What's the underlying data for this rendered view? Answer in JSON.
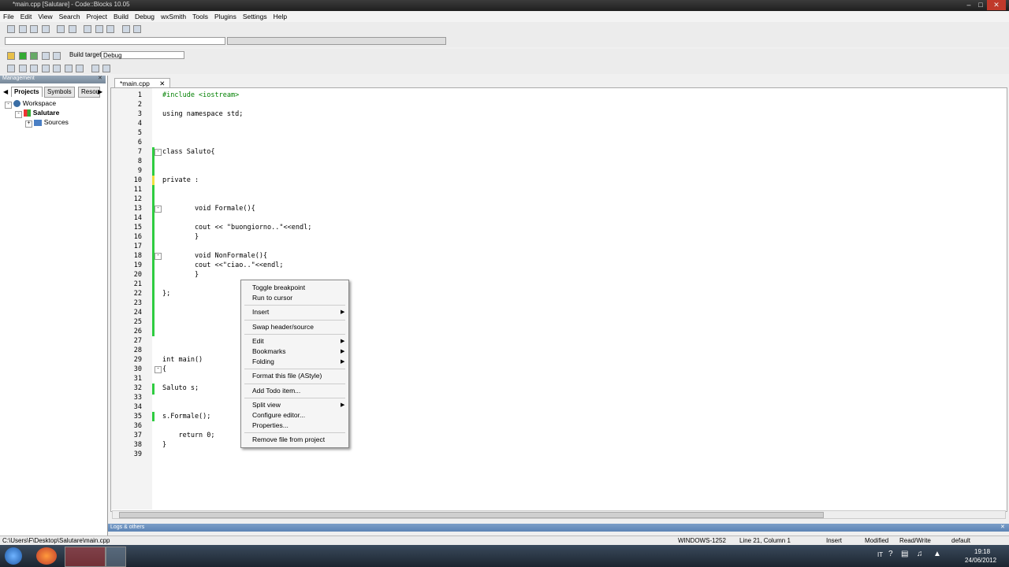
{
  "window": {
    "title": "*main.cpp [Salutare] - Code::Blocks 10.05"
  },
  "menu": [
    "File",
    "Edit",
    "View",
    "Search",
    "Project",
    "Build",
    "Debug",
    "wxSmith",
    "Tools",
    "Plugins",
    "Settings",
    "Help"
  ],
  "build": {
    "label": "Build target:",
    "value": "Debug"
  },
  "management": {
    "title": "Management",
    "tabs": [
      "Projects",
      "Symbols",
      "Resou"
    ],
    "tree": {
      "workspace": "Workspace",
      "project": "Salutare",
      "folder": "Sources"
    }
  },
  "editor": {
    "tab": "*main.cpp",
    "lines": [
      {
        "n": "1",
        "t": "#include <iostream>",
        "cls": "pre"
      },
      {
        "n": "2",
        "t": ""
      },
      {
        "n": "3",
        "t": "using namespace std;"
      },
      {
        "n": "4",
        "t": ""
      },
      {
        "n": "5",
        "t": ""
      },
      {
        "n": "6",
        "t": ""
      },
      {
        "n": "7",
        "t": "class Saluto{"
      },
      {
        "n": "8",
        "t": ""
      },
      {
        "n": "9",
        "t": ""
      },
      {
        "n": "10",
        "t": "private :"
      },
      {
        "n": "11",
        "t": ""
      },
      {
        "n": "12",
        "t": ""
      },
      {
        "n": "13",
        "t": "        void Formale(){"
      },
      {
        "n": "14",
        "t": ""
      },
      {
        "n": "15",
        "t": "        cout << \"buongiorno..\"<<endl;"
      },
      {
        "n": "16",
        "t": "        }"
      },
      {
        "n": "17",
        "t": ""
      },
      {
        "n": "18",
        "t": "        void NonFormale(){"
      },
      {
        "n": "19",
        "t": "        cout <<\"ciao..\"<<endl;"
      },
      {
        "n": "20",
        "t": "        }"
      },
      {
        "n": "21",
        "t": ""
      },
      {
        "n": "22",
        "t": "};"
      },
      {
        "n": "23",
        "t": ""
      },
      {
        "n": "24",
        "t": ""
      },
      {
        "n": "25",
        "t": ""
      },
      {
        "n": "26",
        "t": ""
      },
      {
        "n": "27",
        "t": ""
      },
      {
        "n": "28",
        "t": ""
      },
      {
        "n": "29",
        "t": "int main()"
      },
      {
        "n": "30",
        "t": "{"
      },
      {
        "n": "31",
        "t": ""
      },
      {
        "n": "32",
        "t": "Saluto s;"
      },
      {
        "n": "33",
        "t": ""
      },
      {
        "n": "34",
        "t": ""
      },
      {
        "n": "35",
        "t": "s.Formale();"
      },
      {
        "n": "36",
        "t": ""
      },
      {
        "n": "37",
        "t": "    return 0;"
      },
      {
        "n": "38",
        "t": "}"
      },
      {
        "n": "39",
        "t": ""
      }
    ]
  },
  "context_menu": [
    {
      "label": "Toggle breakpoint",
      "arrow": false
    },
    {
      "label": "Run to cursor",
      "arrow": false
    },
    {
      "sep": true
    },
    {
      "label": "Insert",
      "arrow": true
    },
    {
      "sep": true
    },
    {
      "label": "Swap header/source",
      "arrow": false
    },
    {
      "sep": true
    },
    {
      "label": "Edit",
      "arrow": true
    },
    {
      "label": "Bookmarks",
      "arrow": true
    },
    {
      "label": "Folding",
      "arrow": true
    },
    {
      "sep": true
    },
    {
      "label": "Format this file (AStyle)",
      "arrow": false
    },
    {
      "sep": true
    },
    {
      "label": "Add Todo item...",
      "arrow": false
    },
    {
      "sep": true
    },
    {
      "label": "Split view",
      "arrow": true
    },
    {
      "label": "Configure editor...",
      "arrow": false
    },
    {
      "label": "Properties...",
      "arrow": false
    },
    {
      "sep": true
    },
    {
      "label": "Remove file from project",
      "arrow": false
    }
  ],
  "logs": {
    "title": "Logs & others"
  },
  "status": {
    "path": "C:\\Users\\F\\Desktop\\Salutare\\main.cpp",
    "encoding": "WINDOWS-1252",
    "position": "Line 21, Column 1",
    "mode": "Insert",
    "modified": "Modified",
    "access": "Read/Write",
    "profile": "default"
  },
  "taskbar": {
    "lang": "IT",
    "time": "19:18",
    "date": "24/06/2012"
  },
  "colors": {
    "accent": "#2ecc40",
    "logs": "#5d84b5"
  }
}
